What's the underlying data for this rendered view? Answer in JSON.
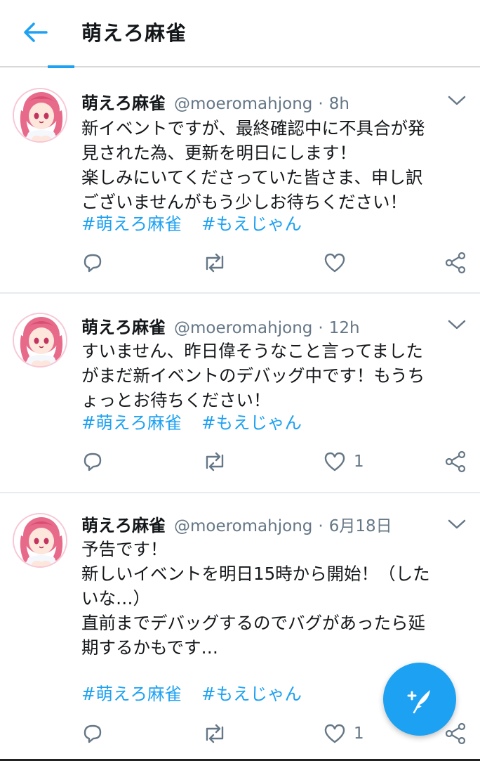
{
  "header": {
    "title": "萌えろ麻雀",
    "back_icon": "arrow-left-icon"
  },
  "colors": {
    "accent": "#1da1f2",
    "text_primary": "#14171a",
    "text_secondary": "#657786",
    "divider": "#e6ecf0"
  },
  "tweets": [
    {
      "name": "萌えろ麻雀",
      "handle": "@moeromahjong",
      "dot": "·",
      "time": "8h",
      "lines": [
        "新イベントですが、最終確認中に不具合が発",
        "見された為、更新を明日にします！",
        "楽しみにいてくださっていた皆さま、申し訳",
        "ございませんがもう少しお待ちください！"
      ],
      "tags": [
        "#萌えろ麻雀",
        "#もえじゃん"
      ],
      "likes": ""
    },
    {
      "name": "萌えろ麻雀",
      "handle": "@moeromahjong",
      "dot": "·",
      "time": "12h",
      "lines": [
        "すいません、昨日偉そうなこと言ってました",
        "がまだ新イベントのデバッグ中です！もうち",
        "ょっとお待ちください！"
      ],
      "tags": [
        "#萌えろ麻雀",
        "#もえじゃん"
      ],
      "likes": "1"
    },
    {
      "name": "萌えろ麻雀",
      "handle": "@moeromahjong",
      "dot": "·",
      "time": "6月18日",
      "lines": [
        "予告です！",
        "新しいイベントを明日15時から開始！（した",
        "いな…）",
        "直前までデバッグするのでバグがあったら延",
        "期するかもです…"
      ],
      "tags": [
        "#萌えろ麻雀",
        "#もえじゃん"
      ],
      "likes": "1"
    }
  ],
  "icons": {
    "reply": "reply-icon",
    "retweet": "retweet-icon",
    "like": "heart-icon",
    "share": "share-icon",
    "more": "chevron-down-icon",
    "compose": "compose-tweet-icon"
  }
}
